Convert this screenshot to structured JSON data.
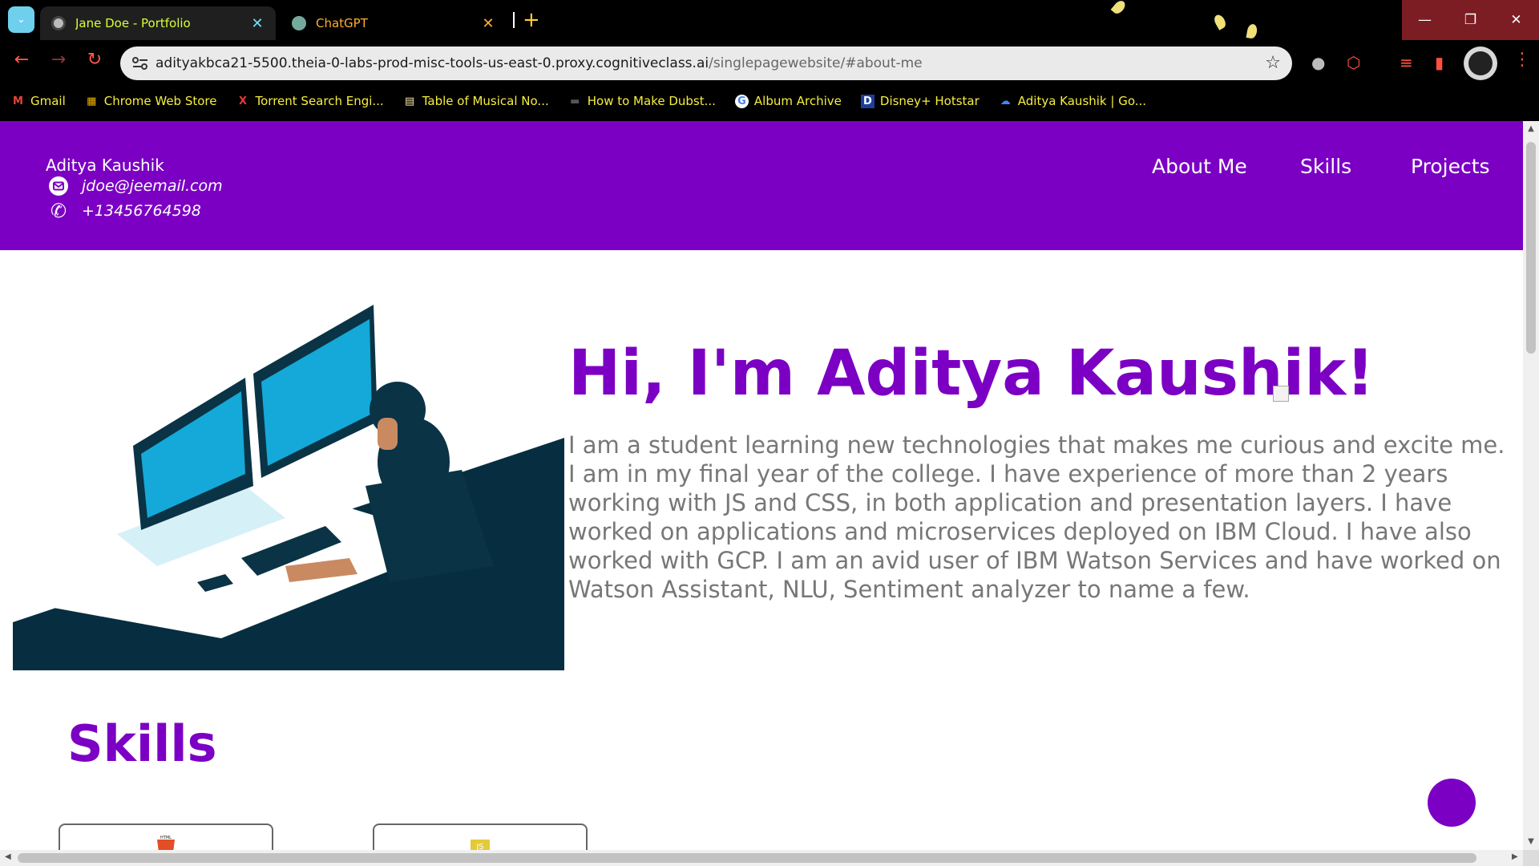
{
  "browser": {
    "tabs": [
      {
        "title": "Jane Doe - Portfolio",
        "active": true
      },
      {
        "title": "ChatGPT",
        "active": false
      }
    ],
    "new_tab_label": "+",
    "close_glyph": "✕",
    "url_host": "adityakbca21-5500.theia-0-labs-prod-misc-tools-us-east-0.proxy.cognitiveclass.ai",
    "url_path": "/singlepagewebsite/#about-me",
    "bookmarks": [
      {
        "label": "Gmail",
        "icon": "gmail-icon",
        "glyph": "M",
        "color": "#ea4335"
      },
      {
        "label": "Chrome Web Store",
        "icon": "chrome-web-store-icon",
        "glyph": "▦",
        "color": "#f4b400"
      },
      {
        "label": "Torrent Search Engi...",
        "icon": "torrent-x-icon",
        "glyph": "X",
        "color": "#e53935"
      },
      {
        "label": "Table of Musical No...",
        "icon": "document-icon",
        "glyph": "▤",
        "color": "#fbe9a8"
      },
      {
        "label": "How to Make Dubst...",
        "icon": "site-icon",
        "glyph": "▬",
        "color": "#555555"
      },
      {
        "label": "Album Archive",
        "icon": "google-icon",
        "glyph": "G",
        "color": "#ffffff"
      },
      {
        "label": "Disney+ Hotstar",
        "icon": "hotstar-icon",
        "glyph": "D",
        "color": "#1c3f9e"
      },
      {
        "label": "Aditya Kaushik | Go...",
        "icon": "google-cloud-icon",
        "glyph": "☁",
        "color": "#4285f4"
      }
    ]
  },
  "site": {
    "name": "Aditya Kaushik",
    "email": "jdoe@jeemail.com",
    "phone": "+13456764598",
    "nav": [
      "About Me",
      "Skills",
      "Projects"
    ],
    "hero_title": "Hi, I'm Aditya Kaushik!",
    "about_text": "I am a student learning new technologies that makes me curious and excite me. I am in my final year of the college. I have experience of more than 2 years working with JS and CSS, in both application and presentation layers. I have worked on applications and microservices deployed on IBM Cloud. I have also worked with GCP. I am an avid user of IBM Watson Services and have worked on Watson Assistant, NLU, Sentiment analyzer to name a few.",
    "skills_title": "Skills",
    "skill_cards": [
      {
        "icon": "html5-logo-icon",
        "logo_text": "HTML"
      },
      {
        "icon": "javascript-logo-icon",
        "logo_text": "JS"
      }
    ]
  },
  "colors": {
    "accent": "#7b00c4",
    "body_text": "#777777",
    "tab_active_text": "#d8ff3a",
    "bookmark_text": "#f7ee3e"
  }
}
